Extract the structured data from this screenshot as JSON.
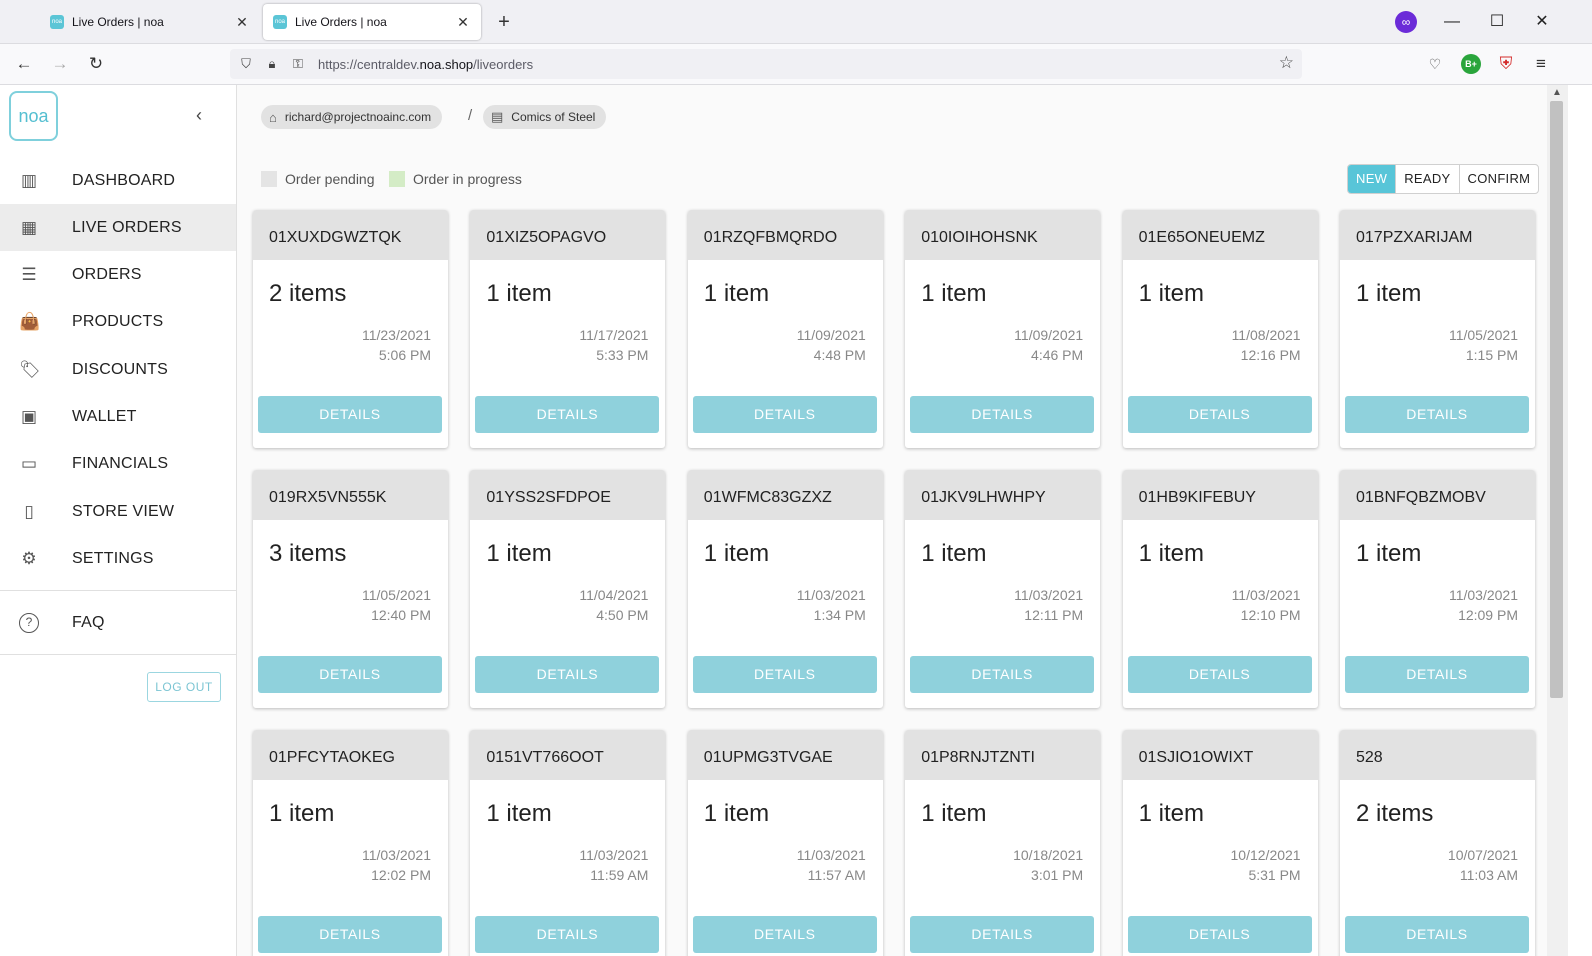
{
  "browser": {
    "tabs": [
      {
        "title": "Live Orders | noa",
        "active": false
      },
      {
        "title": "Live Orders | noa",
        "active": true
      }
    ],
    "favicon_text": "noa",
    "url_prefix": "https://centraldev.",
    "url_domain": "noa.shop",
    "url_path": "/liveorders",
    "private_badge": "∞",
    "ext_green": "B+"
  },
  "sidebar": {
    "logo": "noa",
    "items": [
      {
        "label": "DASHBOARD",
        "icon": "dashboard-icon",
        "glyph": "▥"
      },
      {
        "label": "LIVE ORDERS",
        "icon": "grid-icon",
        "glyph": "▦"
      },
      {
        "label": "ORDERS",
        "icon": "list-icon",
        "glyph": "☰"
      },
      {
        "label": "PRODUCTS",
        "icon": "shopping-bag-icon",
        "glyph": "👜"
      },
      {
        "label": "DISCOUNTS",
        "icon": "tag-icon",
        "glyph": "🏷"
      },
      {
        "label": "WALLET",
        "icon": "wallet-icon",
        "glyph": "▣"
      },
      {
        "label": "FINANCIALS",
        "icon": "credit-card-icon",
        "glyph": "▭"
      },
      {
        "label": "STORE VIEW",
        "icon": "phone-icon",
        "glyph": "▯"
      },
      {
        "label": "SETTINGS",
        "icon": "gear-icon",
        "glyph": "⚙"
      }
    ],
    "faq": {
      "label": "FAQ",
      "icon": "help-icon",
      "glyph": "?"
    },
    "logout_label": "LOG OUT"
  },
  "breadcrumb": {
    "user": "richard@projectnoainc.com",
    "separator": "/",
    "store": "Comics of Steel"
  },
  "legend": {
    "pending": {
      "label": "Order pending",
      "color": "#e4e4e4"
    },
    "in_progress": {
      "label": "Order in progress",
      "color": "#d4ecc6"
    }
  },
  "filters": {
    "options": [
      "NEW",
      "READY",
      "CONFIRM"
    ],
    "selected": "NEW",
    "accent": "#58c5d8"
  },
  "details_label": "DETAILS",
  "orders": [
    {
      "id": "01XUXDGWZTQK",
      "count": "2 items",
      "date": "11/23/2021",
      "time": "5:06 PM"
    },
    {
      "id": "01XIZ5OPAGVO",
      "count": "1 item",
      "date": "11/17/2021",
      "time": "5:33 PM"
    },
    {
      "id": "01RZQFBMQRDO",
      "count": "1 item",
      "date": "11/09/2021",
      "time": "4:48 PM"
    },
    {
      "id": "010IOIHOHSNK",
      "count": "1 item",
      "date": "11/09/2021",
      "time": "4:46 PM"
    },
    {
      "id": "01E65ONEUEMZ",
      "count": "1 item",
      "date": "11/08/2021",
      "time": "12:16 PM"
    },
    {
      "id": "017PZXARIJAM",
      "count": "1 item",
      "date": "11/05/2021",
      "time": "1:15 PM"
    },
    {
      "id": "019RX5VN555K",
      "count": "3 items",
      "date": "11/05/2021",
      "time": "12:40 PM"
    },
    {
      "id": "01YSS2SFDPOE",
      "count": "1 item",
      "date": "11/04/2021",
      "time": "4:50 PM"
    },
    {
      "id": "01WFMC83GZXZ",
      "count": "1 item",
      "date": "11/03/2021",
      "time": "1:34 PM"
    },
    {
      "id": "01JKV9LHWHPY",
      "count": "1 item",
      "date": "11/03/2021",
      "time": "12:11 PM"
    },
    {
      "id": "01HB9KIFEBUY",
      "count": "1 item",
      "date": "11/03/2021",
      "time": "12:10 PM"
    },
    {
      "id": "01BNFQBZMOBV",
      "count": "1 item",
      "date": "11/03/2021",
      "time": "12:09 PM"
    },
    {
      "id": "01PFCYTAOKEG",
      "count": "1 item",
      "date": "11/03/2021",
      "time": "12:02 PM"
    },
    {
      "id": "0151VT766OOT",
      "count": "1 item",
      "date": "11/03/2021",
      "time": "11:59 AM"
    },
    {
      "id": "01UPMG3TVGAE",
      "count": "1 item",
      "date": "11/03/2021",
      "time": "11:57 AM"
    },
    {
      "id": "01P8RNJTZNTI",
      "count": "1 item",
      "date": "10/18/2021",
      "time": "3:01 PM"
    },
    {
      "id": "01SJIO1OWIXT",
      "count": "1 item",
      "date": "10/12/2021",
      "time": "5:31 PM"
    },
    {
      "id": "528",
      "count": "2 items",
      "date": "10/07/2021",
      "time": "11:03 AM"
    }
  ]
}
